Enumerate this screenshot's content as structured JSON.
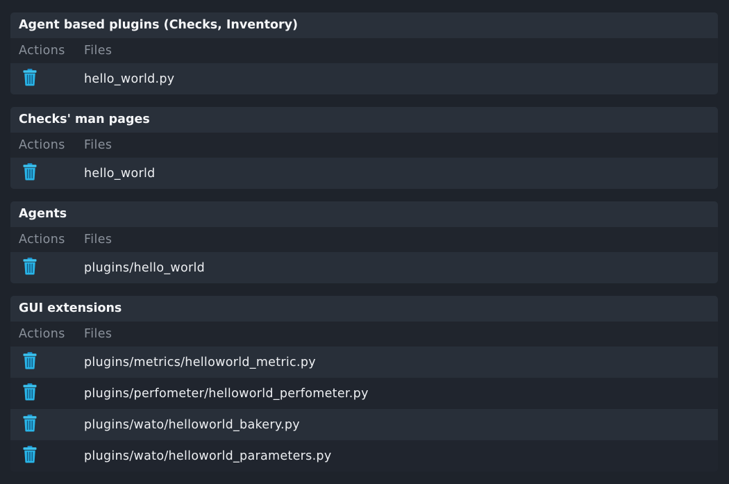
{
  "sections": [
    {
      "title": "Agent based plugins (Checks, Inventory)",
      "actions_header": "Actions",
      "files_header": "Files",
      "files": [
        "hello_world.py"
      ]
    },
    {
      "title": "Checks' man pages",
      "actions_header": "Actions",
      "files_header": "Files",
      "files": [
        "hello_world"
      ]
    },
    {
      "title": "Agents",
      "actions_header": "Actions",
      "files_header": "Files",
      "files": [
        "plugins/hello_world"
      ]
    },
    {
      "title": "GUI extensions",
      "actions_header": "Actions",
      "files_header": "Files",
      "files": [
        "plugins/metrics/helloworld_metric.py",
        "plugins/perfometer/helloworld_perfometer.py",
        "plugins/wato/helloworld_bakery.py",
        "plugins/wato/helloworld_parameters.py"
      ]
    }
  ],
  "icons": {
    "delete": "trash-icon"
  },
  "colors": {
    "background": "#1e232b",
    "panel": "#262c36",
    "accent_icon": "#29b5e8"
  }
}
